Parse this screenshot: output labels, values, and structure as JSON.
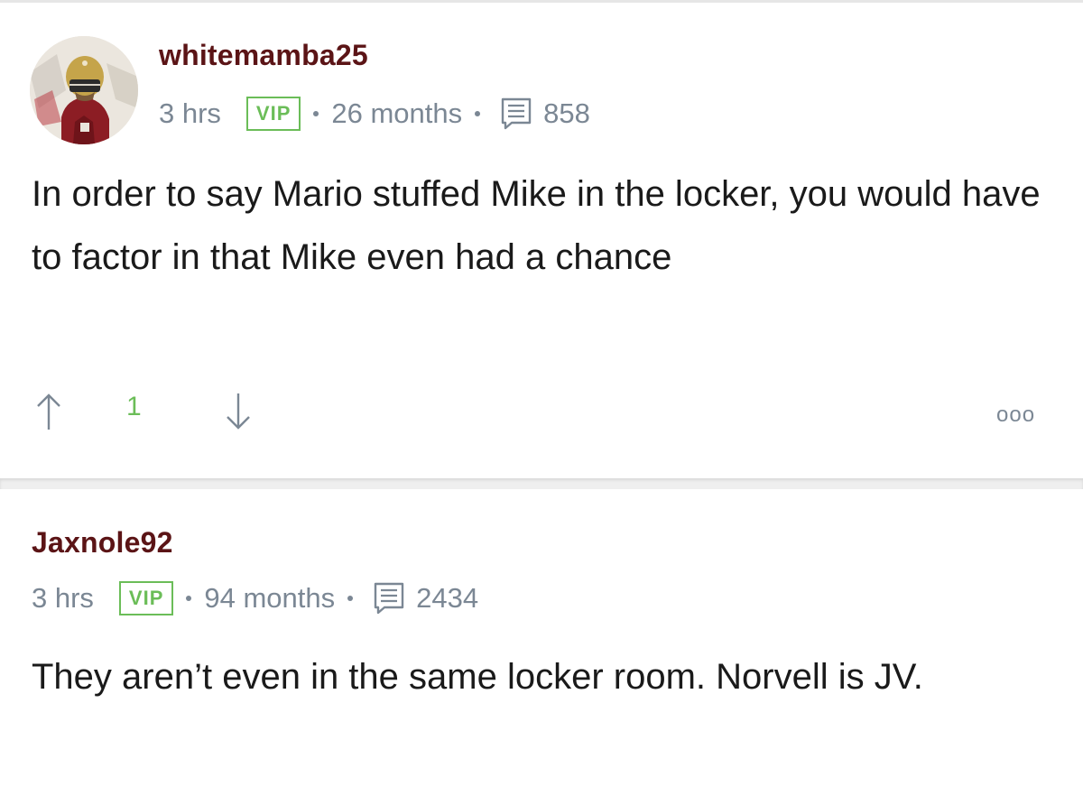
{
  "posts": [
    {
      "username": "whitemamba25",
      "time": "3 hrs",
      "badge": "VIP",
      "tenure": "26 months",
      "post_count": "858",
      "body": "In order to say Mario stuffed Mike in the locker, you would have to factor in that Mike even had a chance",
      "votes": "1",
      "more_label": "ooo"
    },
    {
      "username": "Jaxnole92",
      "time": "3 hrs",
      "badge": "VIP",
      "tenure": "94 months",
      "post_count": "2434",
      "body": "They aren’t even in the same locker room. Norvell is JV."
    }
  ],
  "colors": {
    "username": "#5b1416",
    "meta": "#7b8794",
    "accent_green": "#6bbd58",
    "body_text": "#1a1a1a"
  },
  "icons": [
    "avatar",
    "comments-icon",
    "arrow-up-icon",
    "arrow-down-icon"
  ]
}
